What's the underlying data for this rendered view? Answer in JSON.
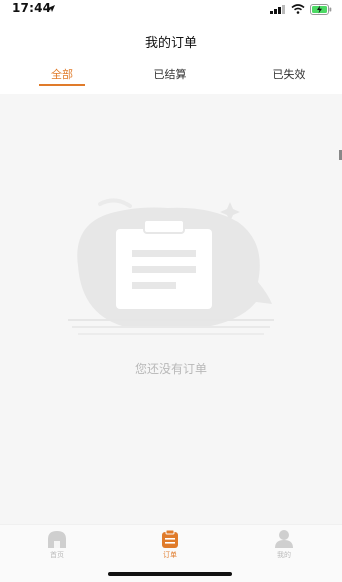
{
  "status_bar": {
    "time": "17:44"
  },
  "nav": {
    "title": "我的订单"
  },
  "tabs": [
    {
      "label": "全部",
      "active": true
    },
    {
      "label": "已结算",
      "active": false
    },
    {
      "label": "已失效",
      "active": false
    }
  ],
  "empty_state": {
    "message": "您还没有订单"
  },
  "tab_bar": {
    "items": [
      {
        "label": "首页",
        "icon": "home-icon",
        "active": false
      },
      {
        "label": "订单",
        "icon": "orders-icon",
        "active": true
      },
      {
        "label": "我的",
        "icon": "profile-icon",
        "active": false
      }
    ]
  },
  "colors": {
    "accent": "#e07b2a",
    "background": "#f6f6f6"
  }
}
